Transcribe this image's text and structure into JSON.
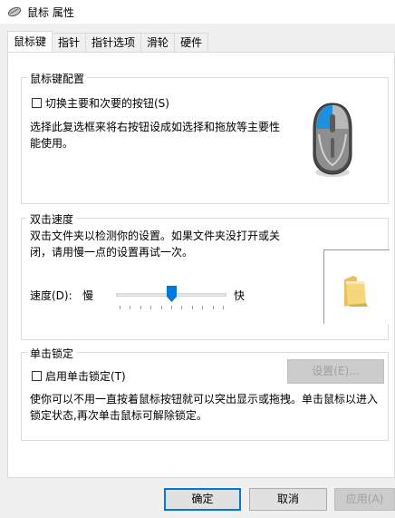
{
  "window": {
    "title": "鼠标 属性",
    "app_icon": "mouse-icon"
  },
  "tabs": [
    {
      "label": "鼠标键",
      "active": true
    },
    {
      "label": "指针",
      "active": false
    },
    {
      "label": "指针选项",
      "active": false
    },
    {
      "label": "滑轮",
      "active": false
    },
    {
      "label": "硬件",
      "active": false
    }
  ],
  "button_config": {
    "title": "鼠标键配置",
    "swap_label": "切换主要和次要的按钮(S)",
    "swap_checked": false,
    "description": "选择此复选框来将右按钮设成如选择和拖放等主要性能使用。",
    "image_icon": "mouse-image-icon"
  },
  "double_click": {
    "title": "双击速度",
    "description": "双击文件夹以检测你的设置。如果文件夹没打开或关闭，请用慢一点的设置再试一次。",
    "speed_label": "速度(D):",
    "slow_label": "慢",
    "fast_label": "快",
    "speed_value_percent": 50,
    "test_icon": "folder-icon"
  },
  "click_lock": {
    "title": "单击锁定",
    "enable_label": "启用单击锁定(T)",
    "enable_checked": false,
    "settings_button": "设置(E)...",
    "description": "使你可以不用一直按着鼠标按钮就可以突出显示或拖拽。单击鼠标以进入锁定状态,再次单击鼠标可解除锁定。"
  },
  "footer": {
    "ok": "确定",
    "cancel": "取消",
    "apply": "应用(A)"
  }
}
